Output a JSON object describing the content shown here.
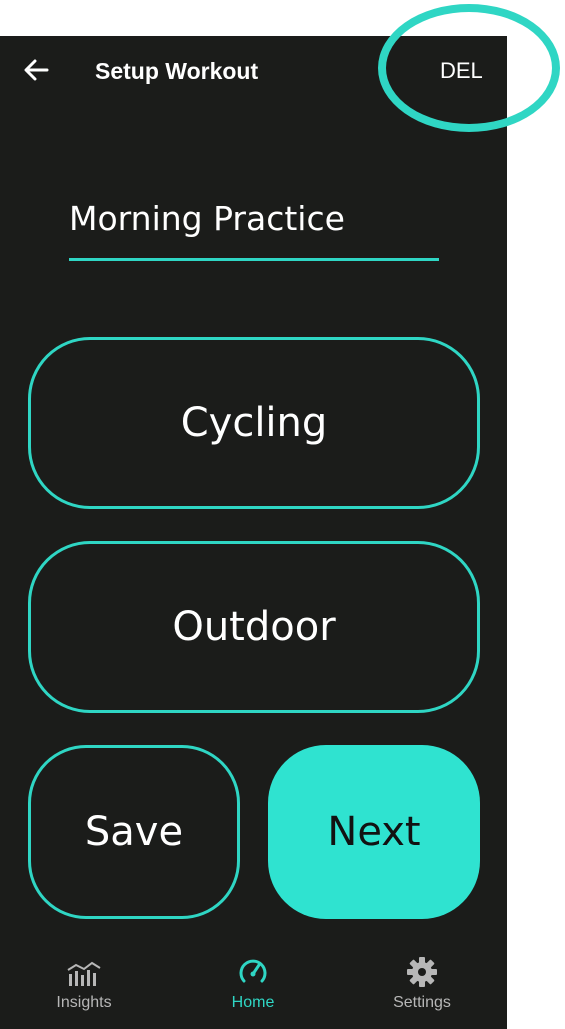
{
  "appbar": {
    "title": "Setup Workout",
    "delete_label": "DEL"
  },
  "workout": {
    "name": "Morning Practice"
  },
  "activity": {
    "type": "Cycling",
    "environment": "Outdoor"
  },
  "actions": {
    "save_label": "Save",
    "next_label": "Next"
  },
  "nav": {
    "items": [
      {
        "label": "Insights",
        "icon": "insights-chart-icon",
        "active": false
      },
      {
        "label": "Home",
        "icon": "speedometer-icon",
        "active": true
      },
      {
        "label": "Settings",
        "icon": "gear-icon",
        "active": false
      }
    ]
  },
  "colors": {
    "accent": "#2fd6c4",
    "background": "#1b1c1a",
    "next_fill": "#2fe3d0"
  }
}
